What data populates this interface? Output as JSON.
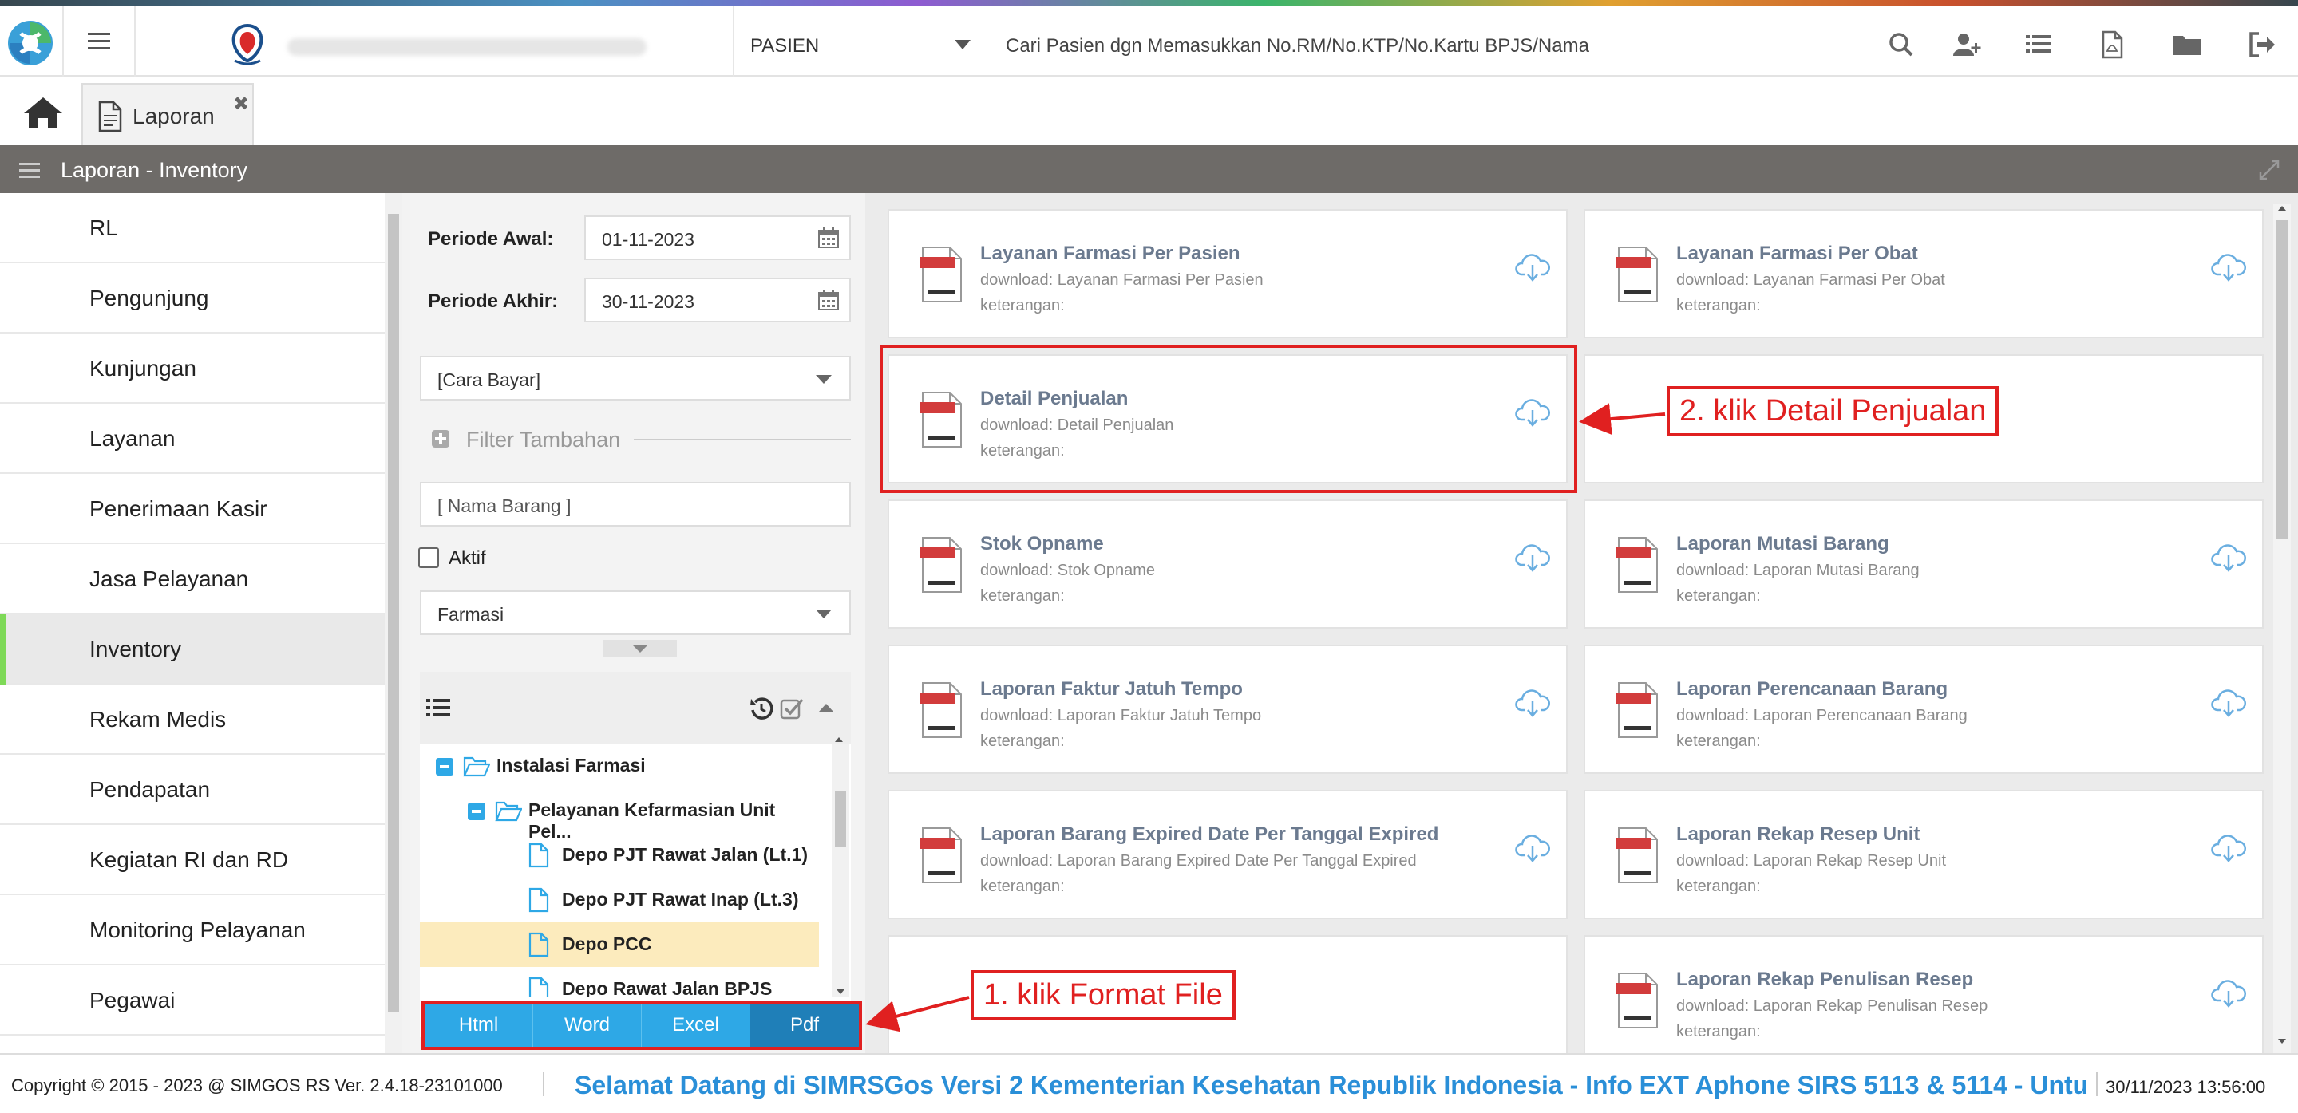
{
  "topbar": {
    "dropdown_label": "PASIEN",
    "search_placeholder": "Cari Pasien dgn Memasukkan No.RM/No.KTP/No.Kartu BPJS/Nama",
    "icons": [
      "search-icon",
      "add-user-icon",
      "list-icon",
      "pdf-file-icon",
      "folder-icon",
      "logout-icon"
    ]
  },
  "tabs": {
    "active_label": "Laporan"
  },
  "section": {
    "title": "Laporan - Inventory"
  },
  "sidebar": {
    "items": [
      {
        "label": "RL"
      },
      {
        "label": "Pengunjung"
      },
      {
        "label": "Kunjungan"
      },
      {
        "label": "Layanan"
      },
      {
        "label": "Penerimaan Kasir"
      },
      {
        "label": "Jasa Pelayanan"
      },
      {
        "label": "Inventory",
        "active": true
      },
      {
        "label": "Rekam Medis"
      },
      {
        "label": "Pendapatan"
      },
      {
        "label": "Kegiatan RI dan RD"
      },
      {
        "label": "Monitoring Pelayanan"
      },
      {
        "label": "Pegawai"
      }
    ]
  },
  "filter": {
    "periode_awal_label": "Periode Awal:",
    "periode_awal_value": "01-11-2023",
    "periode_akhir_label": "Periode Akhir:",
    "periode_akhir_value": "30-11-2023",
    "cara_bayar": "[Cara Bayar]",
    "filter_tambahan": "Filter Tambahan",
    "nama_barang": "[ Nama Barang ]",
    "aktif_label": "Aktif",
    "farmasi": "Farmasi",
    "tree": [
      {
        "label": "Instalasi Farmasi",
        "level": 0,
        "type": "folder"
      },
      {
        "label": "Pelayanan Kefarmasian Unit Pel...",
        "level": 1,
        "type": "folder"
      },
      {
        "label": "Depo PJT Rawat Jalan (Lt.1)",
        "level": 2,
        "type": "file"
      },
      {
        "label": "Depo PJT Rawat Inap (Lt.3)",
        "level": 2,
        "type": "file"
      },
      {
        "label": "Depo PCC",
        "level": 2,
        "type": "file",
        "selected": true
      },
      {
        "label": "Depo Rawat Jalan BPJS",
        "level": 2,
        "type": "file"
      }
    ],
    "formats": [
      "Html",
      "Word",
      "Excel",
      "Pdf"
    ],
    "active_format": "Pdf"
  },
  "cards": [
    {
      "title": "Layanan Farmasi Per Pasien",
      "download": "download: Layanan Farmasi Per Pasien",
      "keterangan": "keterangan:"
    },
    {
      "title": "Layanan Farmasi Per Obat",
      "download": "download: Layanan Farmasi Per Obat",
      "keterangan": "keterangan:"
    },
    {
      "title": "Detail Penjualan",
      "download": "download: Detail Penjualan",
      "keterangan": "keterangan:"
    },
    {
      "title": "",
      "download": "",
      "keterangan": ""
    },
    {
      "title": "Stok Opname",
      "download": "download: Stok Opname",
      "keterangan": "keterangan:"
    },
    {
      "title": "Laporan Mutasi Barang",
      "download": "download: Laporan Mutasi Barang",
      "keterangan": "keterangan:"
    },
    {
      "title": "Laporan Faktur Jatuh Tempo",
      "download": "download: Laporan Faktur Jatuh Tempo",
      "keterangan": "keterangan:"
    },
    {
      "title": "Laporan Perencanaan Barang",
      "download": "download: Laporan Perencanaan Barang",
      "keterangan": "keterangan:"
    },
    {
      "title": "Laporan Barang Expired Date Per Tanggal Expired",
      "download": "download: Laporan Barang Expired Date Per Tanggal Expired",
      "keterangan": "keterangan:"
    },
    {
      "title": "Laporan Rekap Resep Unit",
      "download": "download: Laporan Rekap Resep Unit",
      "keterangan": "keterangan:"
    },
    {
      "title": "",
      "download": "",
      "keterangan": ""
    },
    {
      "title": "Laporan Rekap Penulisan Resep",
      "download": "download: Laporan Rekap Penulisan Resep",
      "keterangan": "keterangan:"
    }
  ],
  "annotations": {
    "step1": "1. klik Format File",
    "step2": "2. klik Detail Penjualan"
  },
  "footer": {
    "copyright": "Copyright © 2015 - 2023 @ SIMGOS RS Ver. 2.4.18-23101000",
    "marquee": "Selamat Datang di SIMRSGos Versi 2 Kementerian Kesehatan Republik Indonesia - Info EXT Aphone SIRS 5113 & 5114 - Untu",
    "datetime": "30/11/2023 13:56:00"
  },
  "colors": {
    "accent_blue": "#2ea8e6",
    "active_format": "#1f7fb8",
    "annotation_red": "#e02020",
    "header_gray": "#6e6b68",
    "active_sidebar": "#7ed957"
  }
}
